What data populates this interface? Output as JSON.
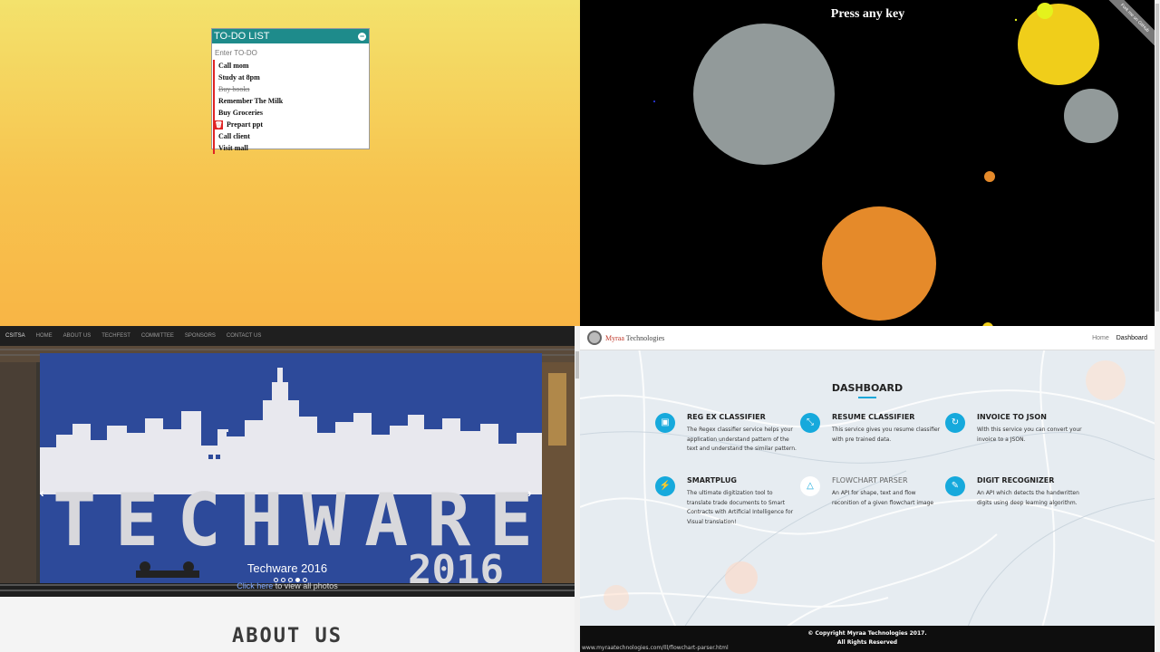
{
  "todo": {
    "title": "TO-DO LIST",
    "toggle": "−",
    "input_placeholder": "Enter TO-DO",
    "items": [
      {
        "label": "Call mom",
        "done": false
      },
      {
        "label": "Study at 8pm",
        "done": false
      },
      {
        "label": "Buy books",
        "done": true
      },
      {
        "label": "Remember The Milk",
        "done": false
      },
      {
        "label": "Buy Groceries",
        "done": false
      },
      {
        "label": "Prepart ppt",
        "done": false,
        "hover": true
      },
      {
        "label": "Call client",
        "done": false
      },
      {
        "label": "Visit mall",
        "done": false
      }
    ],
    "accent": "#1e8b8b",
    "marker": "#e02424"
  },
  "space": {
    "prompt": "Press any key",
    "ribbon": "Fork me on GitHub",
    "colors": {
      "gray": "#929a9a",
      "orange": "#e58a2a",
      "yellow": "#f0ce1a",
      "lime": "#e4f21c"
    }
  },
  "techware": {
    "nav": {
      "brand": "CSITSA",
      "links": [
        "HOME",
        "ABOUT US",
        "TECHFEST",
        "COMMITTEE",
        "SPONSORS",
        "CONTACT US"
      ]
    },
    "slide": {
      "banner_word": "TECHWARE",
      "banner_year": "2016",
      "caption_title": "Techware 2016",
      "caption_link": "Click here",
      "caption_rest": " to view all photos",
      "prev": "‹",
      "next": "›"
    },
    "section_heading": "ABOUT US"
  },
  "dashboard": {
    "brand_prefix": "Myraa",
    "brand_suffix": " Technologies",
    "menu": {
      "home": "Home",
      "active": "Dashboard"
    },
    "title": "DASHBOARD",
    "cards": [
      {
        "title": "REG EX CLASSIFIER",
        "desc": "The Regex classifier service helps your application understand pattern of the text and understand the similar pattern.",
        "icon": "document-icon"
      },
      {
        "title": "RESUME CLASSIFIER",
        "desc": "This service gives you resume classifier with pre trained data.",
        "icon": "shrink-icon"
      },
      {
        "title": "INVOICE TO JSON",
        "desc": "With this service you can convert your invoice to a JSON.",
        "icon": "refresh-icon"
      },
      {
        "title": "SMARTPLUG",
        "desc": "The ultimate digitization tool to translate trade documents to Smart Contracts with Artificial Intelligence for Visual translation!",
        "icon": "plug-icon"
      },
      {
        "title": "FLOWCHART PARSER",
        "desc": "An API for shape, text and flow reconition of a given flowchart image",
        "icon": "sitemap-icon"
      },
      {
        "title": "DIGIT RECOGNIZER",
        "desc": "An API which detects the handwritten digits using deep learning algorithm.",
        "icon": "edit-icon"
      }
    ],
    "footer_line1": "© Copyright Myraa Technologies 2017.",
    "footer_line2": "All Rights Reserved",
    "status_url": "www.myraatechnologies.com/lll/flowchart-parser.html",
    "accent": "#16a9dc"
  }
}
